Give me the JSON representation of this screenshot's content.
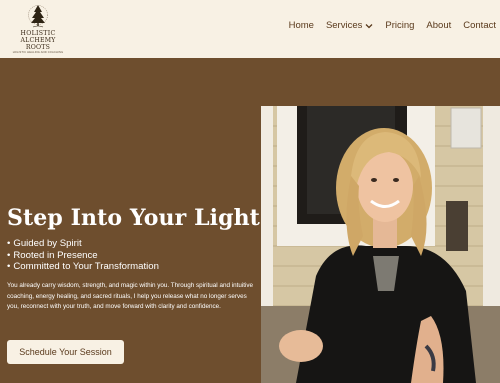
{
  "logo": {
    "line1": "HOLISTIC",
    "line2": "ALCHEMY ROOTS",
    "line3": "HOLISTIC HEALING AND COACHING"
  },
  "nav": {
    "items": [
      {
        "label": "Home"
      },
      {
        "label": "Services",
        "has_dropdown": true
      },
      {
        "label": "Pricing"
      },
      {
        "label": "About"
      },
      {
        "label": "Contact"
      }
    ]
  },
  "hero": {
    "title": "Step Into Your Light",
    "bullets": [
      "Guided by Spirit",
      "Rooted in Presence",
      "Committed to Your Transformation"
    ],
    "paragraph": "You already carry wisdom, strength, and magic within you. Through spiritual and intuitive coaching, energy healing, and sacred rituals, I help you release what no longer serves you, reconnect with your truth, and move forward with clarity and confidence.",
    "cta_label": "Schedule Your Session"
  },
  "colors": {
    "header_bg": "#f8f1e4",
    "hero_bg": "#6e4e2e",
    "nav_text": "#5a3a1c"
  }
}
